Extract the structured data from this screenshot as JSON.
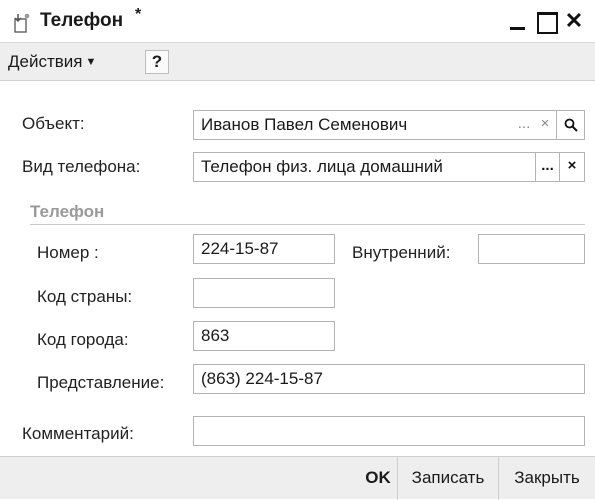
{
  "window": {
    "title": "Телефон",
    "modified_mark": "*",
    "minimize_icon": "minimize-icon",
    "maximize_icon": "maximize-icon",
    "close_glyph": "✕"
  },
  "toolbar": {
    "actions_label": "Действия",
    "help_label": "?"
  },
  "form": {
    "object_label": "Объект:",
    "object_value": "Иванов Павел Семенович",
    "object_buttons": [
      "...",
      "×"
    ],
    "phone_type_label": "Вид телефона:",
    "phone_type_value": "Телефон физ. лица домашний",
    "phone_type_buttons": [
      "...",
      "×"
    ],
    "section_title": "Телефон",
    "number_label": "Номер :",
    "number_value": "224-15-87",
    "internal_label": "Внутренний:",
    "internal_value": "",
    "country_code_label": "Код страны:",
    "country_code_value": "",
    "city_code_label": "Код города:",
    "city_code_value": "863",
    "presentation_label": "Представление:",
    "presentation_value": "(863) 224-15-87",
    "comment_label": "Комментарий:",
    "comment_value": ""
  },
  "footer": {
    "ok_label": "OK",
    "save_label": "Записать",
    "close_label": "Закрыть"
  }
}
